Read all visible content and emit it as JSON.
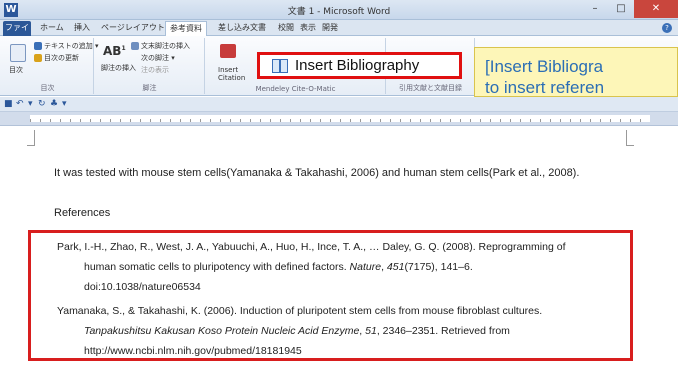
{
  "window": {
    "title": "文書 1 - Microsoft Word",
    "app_icon": "W",
    "controls": [
      "–",
      "□",
      "✕"
    ]
  },
  "tabs": [
    {
      "label": "ファイル"
    },
    {
      "label": "ホーム"
    },
    {
      "label": "挿入"
    },
    {
      "label": "ページレイアウト"
    },
    {
      "label": "参考資料"
    },
    {
      "label": "差し込み文書"
    },
    {
      "label": "校閲"
    },
    {
      "label": "表示"
    },
    {
      "label": "開発"
    }
  ],
  "ribbon": {
    "toc": {
      "label": "目次",
      "group": "目次"
    },
    "footnotes": {
      "add_text": "テキストの追加 ▾",
      "update": "目次の更新",
      "insert_footnote": "脚注の挿入",
      "endnote": "文末脚注の挿入",
      "next_footnote": "次の脚注 ▾",
      "show_notes": "注の表示",
      "group": "脚注"
    },
    "citation": {
      "insert_citation": "Insert Citation",
      "group": "Mendeley Cite-O-Matic"
    },
    "captions": {
      "group": "引用文献と文献目録"
    },
    "insert_bibliography": "Insert Bibliography"
  },
  "callout": {
    "line1": "[Insert Bibliogra",
    "line2": "to insert referen"
  },
  "document": {
    "body_prefix": "It was tested with mouse stem cells(Yamanaka & Takahashi, 2006) and human stem cells(Park et al., 2008).",
    "references_heading": "References",
    "references": [
      {
        "line1": "Park, I.-H., Zhao, R., West, J. A., Yabuuchi, A., Huo, H., Ince, T. A., … Daley, G. Q. (2008). Reprogramming of",
        "line2_prefix": "human somatic cells to pluripotency with defined factors. ",
        "line2_journal": "Nature",
        "line2_sep": ", ",
        "line2_volume": "451",
        "line2_suffix": "(7175), 141–6.",
        "line3": "doi:10.1038/nature06534"
      },
      {
        "line1": "Yamanaka, S., & Takahashi, K. (2006). Induction of pluripotent stem cells from mouse fibroblast cultures.",
        "line2_journal": "Tanpakushitsu Kakusan Koso Protein Nucleic Acid Enzyme",
        "line2_sep": ", ",
        "line2_volume": "51",
        "line2_suffix": ", 2346–2351. Retrieved from",
        "line3": "http://www.ncbi.nlm.nih.gov/pubmed/18181945"
      }
    ]
  }
}
